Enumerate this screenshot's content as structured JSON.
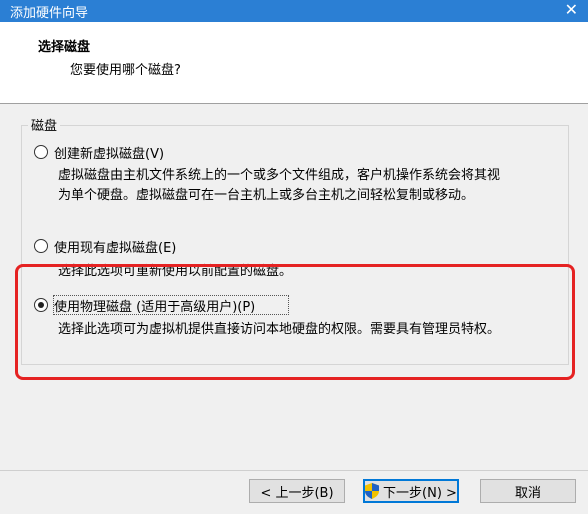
{
  "window": {
    "title": "添加硬件向导",
    "close_label": "✕"
  },
  "header": {
    "title": "选择磁盘",
    "subtitle": "您要使用哪个磁盘?"
  },
  "group": {
    "label": "磁盘"
  },
  "options": [
    {
      "label": "创建新虚拟磁盘(V)",
      "checked": false,
      "description": [
        "虚拟磁盘由主机文件系统上的一个或多个文件组成，客户机操作系统会将其视",
        "为单个硬盘。虚拟磁盘可在一台主机上或多台主机之间轻松复制或移动。"
      ]
    },
    {
      "label": "使用现有虚拟磁盘(E)",
      "checked": false,
      "description": [
        "选择此选项可重新使用以前配置的磁盘。"
      ]
    },
    {
      "label": "使用物理磁盘 (适用于高级用户)(P)",
      "checked": true,
      "description": [
        "选择此选项可为虚拟机提供直接访问本地硬盘的权限。需要具有管理员特权。"
      ]
    }
  ],
  "buttons": {
    "back": "< 上一步(B)",
    "next": "下一步(N) >",
    "cancel": "取消"
  },
  "colors": {
    "titlebar": "#2b7fd4",
    "highlight": "#e52222",
    "default_button_border": "#0078d7"
  },
  "icons": {
    "next_button": "uac-shield-icon"
  }
}
